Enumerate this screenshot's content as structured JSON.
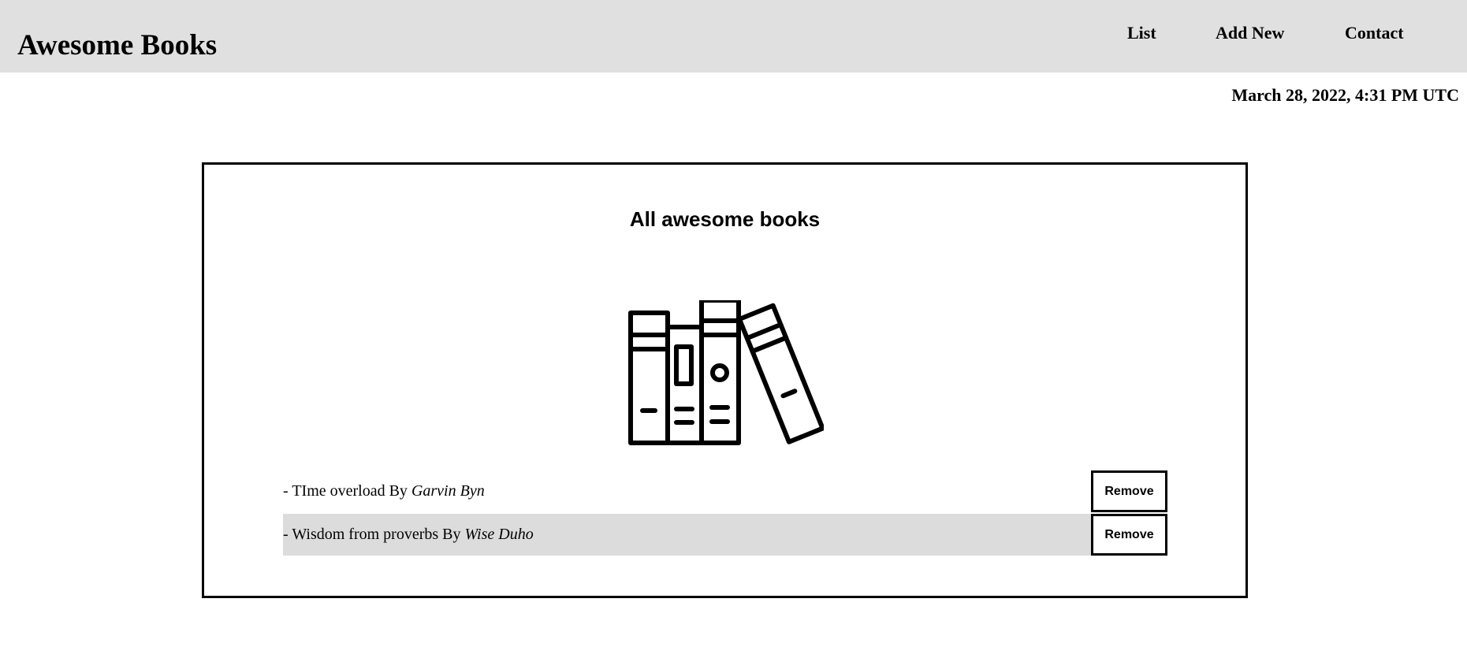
{
  "header": {
    "logo": "Awesome Books",
    "nav": [
      {
        "label": "List"
      },
      {
        "label": "Add New"
      },
      {
        "label": "Contact"
      }
    ]
  },
  "datetime": "March 28, 2022, 4:31 PM UTC",
  "main": {
    "title": "All awesome books",
    "icon": "books-icon",
    "books": [
      {
        "title": "TIme overload",
        "by": "By",
        "author": "Garvin Byn",
        "prefix": "- ",
        "remove_label": "Remove"
      },
      {
        "title": "Wisdom from proverbs",
        "by": "By",
        "author": "Wise Duho",
        "prefix": "- ",
        "remove_label": "Remove"
      }
    ]
  },
  "colors": {
    "header_bg": "#e0e0e0",
    "alt_row_bg": "#dcdcdc",
    "border": "#000000"
  }
}
